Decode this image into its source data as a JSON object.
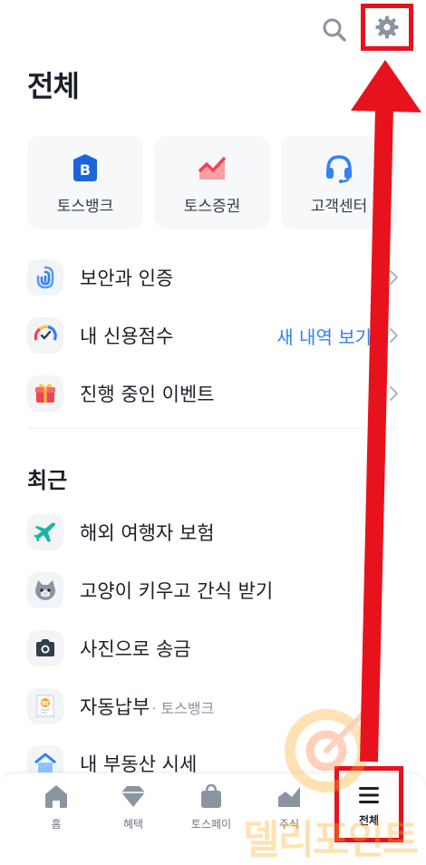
{
  "header": {
    "title": "전체",
    "search_icon": "search-icon",
    "settings_icon": "gear-icon"
  },
  "quick_links": [
    {
      "label": "토스뱅크",
      "icon": "bank-b-icon",
      "color": "#1b64da"
    },
    {
      "label": "토스증권",
      "icon": "stock-chart-icon",
      "color": "#f04452"
    },
    {
      "label": "고객센터",
      "icon": "headset-icon",
      "color": "#3182f6"
    }
  ],
  "menu": [
    {
      "label": "보안과 인증",
      "icon": "security-icon",
      "extra": ""
    },
    {
      "label": "내 신용점수",
      "icon": "credit-gauge-icon",
      "extra": "새 내역 보기"
    },
    {
      "label": "진행 중인 이벤트",
      "icon": "gift-icon",
      "extra": ""
    }
  ],
  "recent": {
    "title": "최근",
    "items": [
      {
        "label": "해외 여행자 보험",
        "sub": "",
        "icon": "airplane-icon"
      },
      {
        "label": "고양이 키우고 간식 받기",
        "sub": "",
        "icon": "cat-icon"
      },
      {
        "label": "사진으로 송금",
        "sub": "",
        "icon": "camera-icon"
      },
      {
        "label": "자동납부",
        "sub": "· 토스뱅크",
        "icon": "bill-icon"
      },
      {
        "label": "내 부동산 시세",
        "sub": "",
        "icon": "house-icon"
      }
    ]
  },
  "tabbar": [
    {
      "label": "홈",
      "icon": "home-icon"
    },
    {
      "label": "혜택",
      "icon": "diamond-icon"
    },
    {
      "label": "토스페이",
      "icon": "shopping-bag-icon"
    },
    {
      "label": "주식",
      "icon": "stock-icon"
    },
    {
      "label": "전체",
      "icon": "menu-icon",
      "active": true
    }
  ],
  "watermark_text": "델리포인트",
  "colors": {
    "accent": "#3182f6",
    "annotation": "#e8121c",
    "text": "#191f28",
    "muted": "#8b95a1"
  }
}
